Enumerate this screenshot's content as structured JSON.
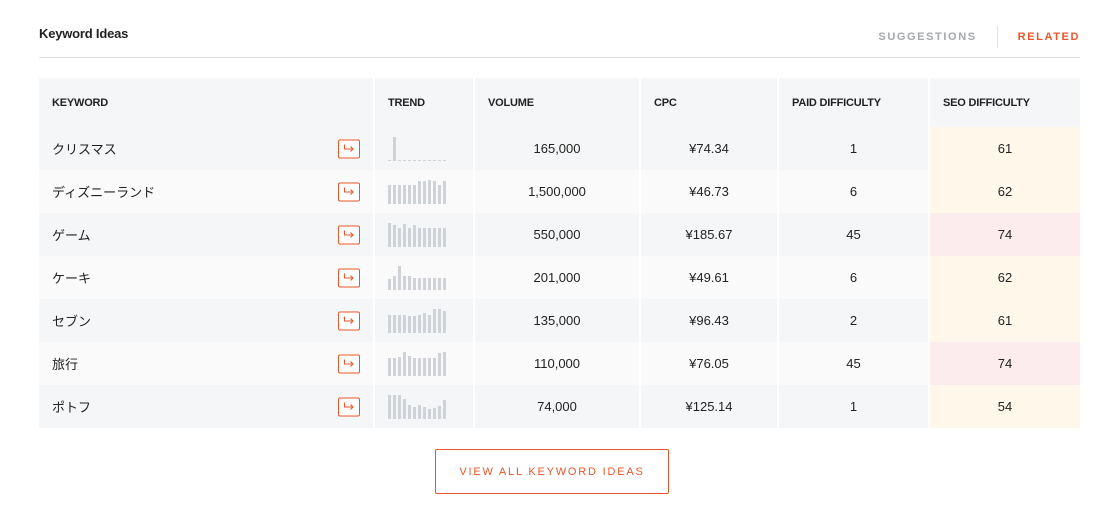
{
  "title": "Keyword Ideas",
  "tabs": [
    {
      "label": "SUGGESTIONS",
      "active": false
    },
    {
      "label": "RELATED",
      "active": true
    }
  ],
  "columns": {
    "keyword": "KEYWORD",
    "trend": "TREND",
    "volume": "VOLUME",
    "cpc": "CPC",
    "paid": "PAID DIFFICULTY",
    "seo": "SEO DIFFICULTY"
  },
  "rows": [
    {
      "keyword": "クリスマス",
      "volume": "165,000",
      "cpc": "¥74.34",
      "paid": "1",
      "seo": "61",
      "seo_level": "med",
      "trend": [
        0.05,
        1.0,
        0.05,
        0,
        0,
        0,
        0,
        0,
        0,
        0,
        0,
        0
      ]
    },
    {
      "keyword": "ディズニーランド",
      "volume": "1,500,000",
      "cpc": "¥46.73",
      "paid": "6",
      "seo": "62",
      "seo_level": "med",
      "trend": [
        0.8,
        0.8,
        0.8,
        0.8,
        0.8,
        0.8,
        0.95,
        0.95,
        1.0,
        0.95,
        0.8,
        0.95
      ]
    },
    {
      "keyword": "ゲーム",
      "volume": "550,000",
      "cpc": "¥185.67",
      "paid": "45",
      "seo": "74",
      "seo_level": "high",
      "trend": [
        1.0,
        0.9,
        0.8,
        0.95,
        0.8,
        0.9,
        0.8,
        0.8,
        0.8,
        0.8,
        0.8,
        0.8
      ]
    },
    {
      "keyword": "ケーキ",
      "volume": "201,000",
      "cpc": "¥49.61",
      "paid": "6",
      "seo": "62",
      "seo_level": "med",
      "trend": [
        0.45,
        0.6,
        1.0,
        0.6,
        0.6,
        0.5,
        0.5,
        0.5,
        0.5,
        0.5,
        0.5,
        0.5
      ]
    },
    {
      "keyword": "セブン",
      "volume": "135,000",
      "cpc": "¥96.43",
      "paid": "2",
      "seo": "61",
      "seo_level": "med",
      "trend": [
        0.75,
        0.75,
        0.75,
        0.75,
        0.7,
        0.7,
        0.75,
        0.85,
        0.75,
        1.0,
        1.0,
        0.9
      ]
    },
    {
      "keyword": "旅行",
      "volume": "110,000",
      "cpc": "¥76.05",
      "paid": "45",
      "seo": "74",
      "seo_level": "high",
      "trend": [
        0.75,
        0.75,
        0.8,
        1.0,
        0.85,
        0.75,
        0.75,
        0.75,
        0.75,
        0.75,
        0.95,
        1.0
      ]
    },
    {
      "keyword": "ポトフ",
      "volume": "74,000",
      "cpc": "¥125.14",
      "paid": "1",
      "seo": "54",
      "seo_level": "med",
      "trend": [
        1.0,
        1.0,
        1.0,
        0.85,
        0.6,
        0.5,
        0.6,
        0.5,
        0.4,
        0.45,
        0.55,
        0.8
      ]
    }
  ],
  "view_all_label": "VIEW ALL KEYWORD IDEAS",
  "colors": {
    "accent": "#e8572a",
    "tab_inactive": "#a4a7ab",
    "seo_medium": "#fff8ea",
    "seo_high": "#fdeced"
  },
  "icons": {
    "row_action": "arrow-return-right-icon"
  }
}
